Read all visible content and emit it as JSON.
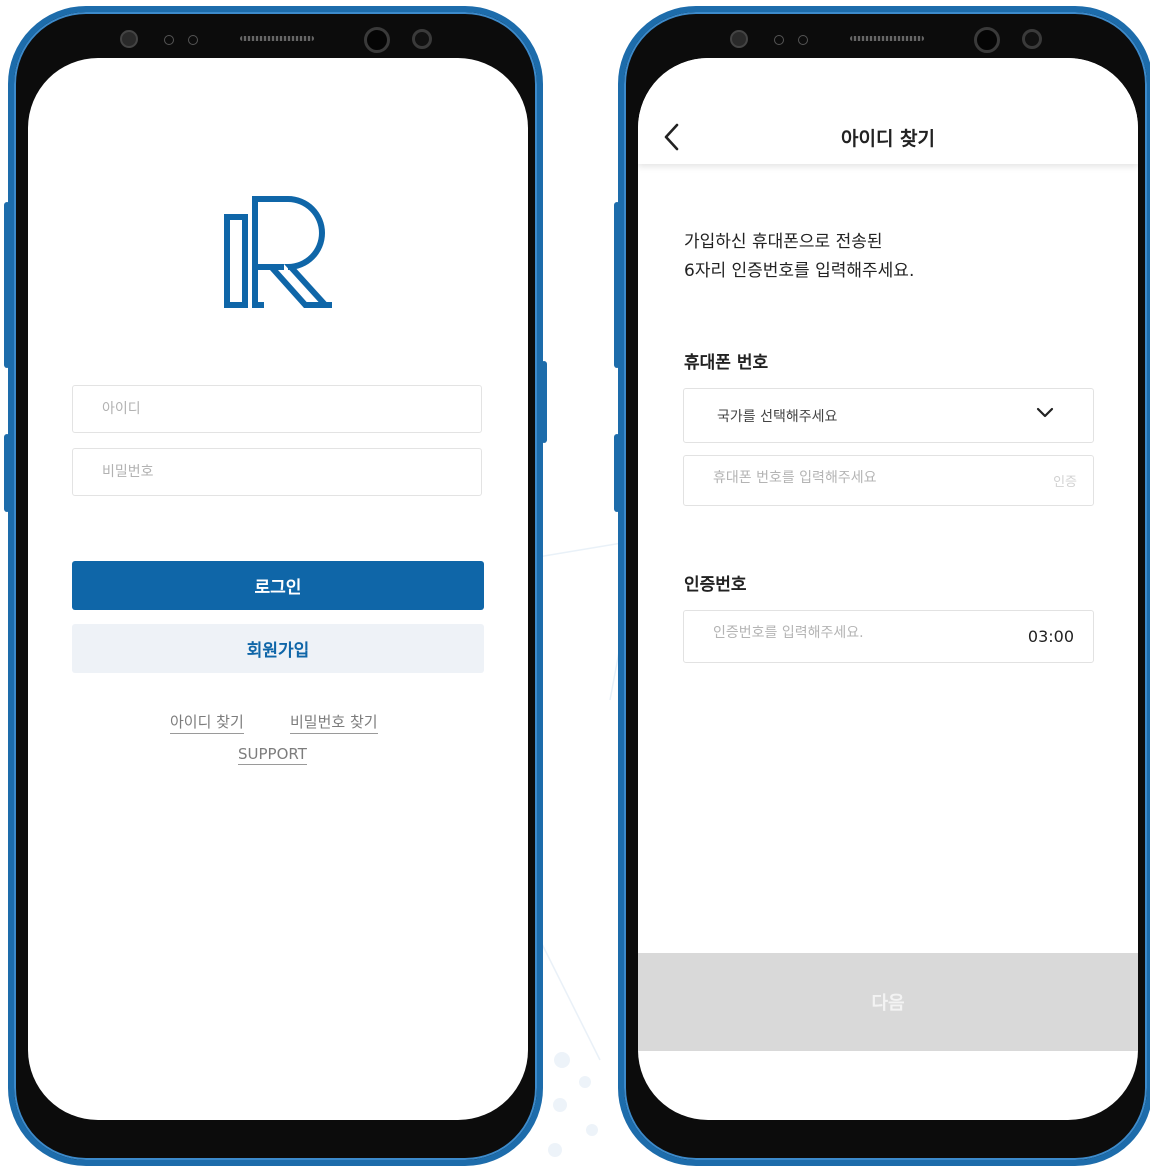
{
  "login_screen": {
    "id_placeholder": "아이디",
    "password_placeholder": "비밀번호",
    "login_button": "로그인",
    "signup_button": "회원가입",
    "find_id_link": "아이디 찾기",
    "find_password_link": "비밀번호 찾기",
    "support_link": "SUPPORT"
  },
  "find_id_screen": {
    "title": "아이디 찾기",
    "description_line1": "가입하신 휴대폰으로 전송된",
    "description_line2": "6자리 인증번호를 입력해주세요.",
    "phone_section_label": "휴대폰 번호",
    "country_select_value": "국가를 선택해주세요",
    "phone_input_placeholder": "휴대폰 번호를 입력해주세요",
    "verify_button": "인증",
    "code_section_label": "인증번호",
    "code_input_placeholder": "인증번호를 입력해주세요.",
    "timer": "03:00",
    "next_button": "다음"
  },
  "colors": {
    "brand_blue": "#0f66a8",
    "phone_frame": "#1d6cab",
    "secondary_button_bg": "#eef2f7",
    "disabled_button_bg": "#d9d9d9"
  }
}
